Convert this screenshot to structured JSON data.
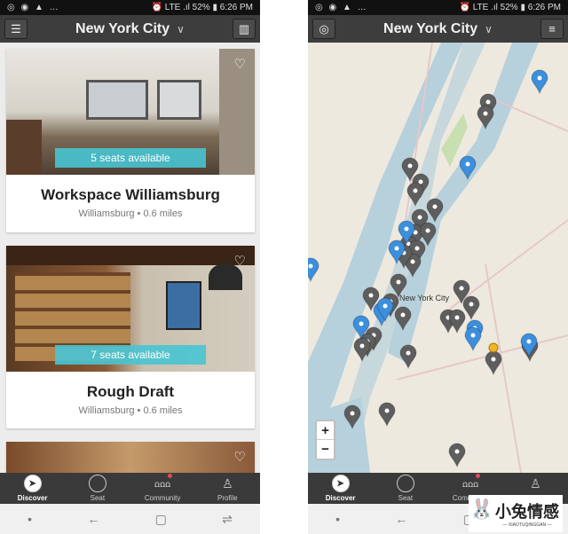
{
  "status": {
    "left_icons": "◎ ◉ ▲ …",
    "right": "⏰ LTE .ıl 52% ▮ 6:26 PM"
  },
  "header": {
    "title": "New York City",
    "chevron": "∨",
    "left_button_icon": "filter-sliders-icon",
    "list_right_button_icon": "map-icon",
    "map_right_button_icon": "menu-icon"
  },
  "listings": [
    {
      "title": "Workspace Williamsburg",
      "subtitle": "Williamsburg • 0.6 miles",
      "seats": "5 seats available"
    },
    {
      "title": "Rough Draft",
      "subtitle": "Williamsburg • 0.6 miles",
      "seats": "7 seats available"
    }
  ],
  "map": {
    "label": "New York City",
    "zoom_in": "+",
    "zoom_out": "−",
    "pin_colors": {
      "gray": "#5e5e5e",
      "blue": "#3b8fdc",
      "current": "#f0b429"
    }
  },
  "nav": {
    "items": [
      {
        "label": "Discover",
        "active": true
      },
      {
        "label": "Seat"
      },
      {
        "label": "Community",
        "badge": true
      },
      {
        "label": "Profile"
      }
    ]
  },
  "watermark": {
    "text": "小兔情感",
    "sub": "— XIAOTUQINGGAN —"
  },
  "colors": {
    "header": "#3d3d3d",
    "seats_badge": "#48c4d2"
  }
}
